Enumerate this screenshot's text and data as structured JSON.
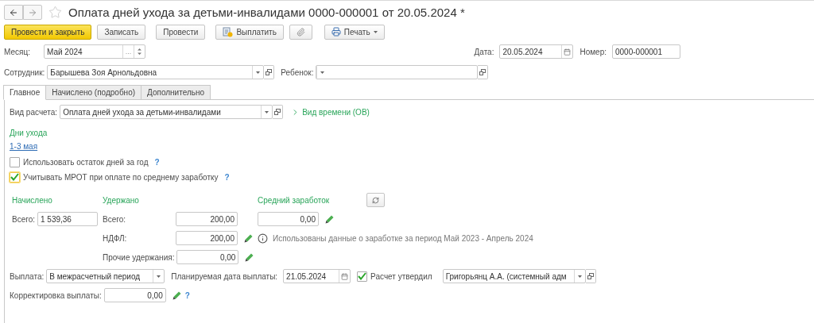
{
  "window": {
    "title": "Оплата дней ухода за детьми-инвалидами 0000-000001 от 20.05.2024 *",
    "favorite": false
  },
  "toolbar": [
    {
      "kind": "primary",
      "label": "Провести и закрыть"
    },
    {
      "kind": "plain",
      "label": "Записать"
    },
    {
      "kind": "plain",
      "label": "Провести"
    },
    {
      "kind": "pay",
      "label": "Выплатить"
    },
    {
      "kind": "attach"
    },
    {
      "kind": "print",
      "label": "Печать"
    }
  ],
  "header": {
    "month": {
      "label": "Месяц:",
      "value": "Май 2024",
      "choice": "..."
    },
    "date": {
      "label": "Дата:",
      "value": "20.05.2024"
    },
    "number": {
      "label": "Номер:",
      "value": "0000-000001"
    },
    "employee": {
      "label": "Сотрудник:",
      "value": "Барышева Зоя Арнольдовна"
    },
    "child": {
      "label": "Ребенок:"
    }
  },
  "tabs": [
    {
      "label": "Главное",
      "selected": true
    },
    {
      "label": "Начислено (подробно)",
      "selected": false
    },
    {
      "label": "Дополнительно",
      "selected": false
    }
  ],
  "main": {
    "calc_type": {
      "label": "Вид расчета:",
      "value": "Оплата дней ухода за детьми-инвалидами"
    },
    "time_link": "Вид времени (ОВ)",
    "care_days_title": "Дни ухода",
    "care_days_link": "1-3 мая",
    "options": [
      {
        "label": "Использовать остаток дней за год",
        "checked": false,
        "focused": false,
        "help": "?"
      },
      {
        "label": "Учитывать МРОТ при оплате по среднему заработку",
        "checked": true,
        "focused": true,
        "help": "?"
      }
    ],
    "accrued": {
      "title": "Начислено",
      "total_label": "Всего:",
      "total": "1 539,36"
    },
    "withheld": {
      "title": "Удержано",
      "rows": [
        {
          "label": "Всего:",
          "value": "200,00",
          "editable": false
        },
        {
          "label": "НДФЛ:",
          "value": "200,00",
          "editable": true
        },
        {
          "label": "Прочие удержания:",
          "value": "0,00",
          "editable": true
        }
      ]
    },
    "average": {
      "title": "Средний заработок",
      "value": "0,00",
      "note": "Использованы данные о заработке за период Май 2023 - Апрель 2024"
    },
    "payment": {
      "label": "Выплата:",
      "value": "В межрасчетный период"
    },
    "planned_date": {
      "label": "Планируемая дата выплаты:",
      "value": "21.05.2024"
    },
    "approved": {
      "label": "Расчет утвердил",
      "checked": true,
      "value": "Григорьянц А.А. (системный адм"
    },
    "correction": {
      "label": "Корректировка выплаты:",
      "value": "0,00",
      "help": "?"
    }
  }
}
